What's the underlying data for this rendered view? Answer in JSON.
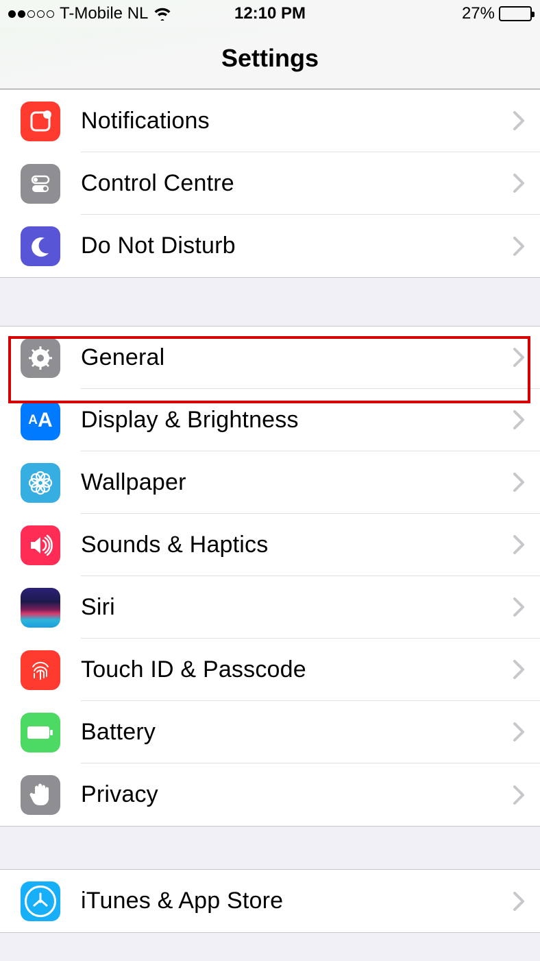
{
  "status": {
    "carrier": "T-Mobile NL",
    "time": "12:10 PM",
    "battery_pct": "27%"
  },
  "title": "Settings",
  "groups": [
    {
      "items": [
        {
          "label": "Notifications",
          "icon": "notifications"
        },
        {
          "label": "Control Centre",
          "icon": "control-centre"
        },
        {
          "label": "Do Not Disturb",
          "icon": "dnd"
        }
      ]
    },
    {
      "items": [
        {
          "label": "General",
          "icon": "general",
          "highlighted": true
        },
        {
          "label": "Display & Brightness",
          "icon": "display"
        },
        {
          "label": "Wallpaper",
          "icon": "wallpaper"
        },
        {
          "label": "Sounds & Haptics",
          "icon": "sounds"
        },
        {
          "label": "Siri",
          "icon": "siri"
        },
        {
          "label": "Touch ID & Passcode",
          "icon": "touchid"
        },
        {
          "label": "Battery",
          "icon": "battery"
        },
        {
          "label": "Privacy",
          "icon": "privacy"
        }
      ]
    },
    {
      "items": [
        {
          "label": "iTunes & App Store",
          "icon": "appstore"
        }
      ]
    }
  ]
}
